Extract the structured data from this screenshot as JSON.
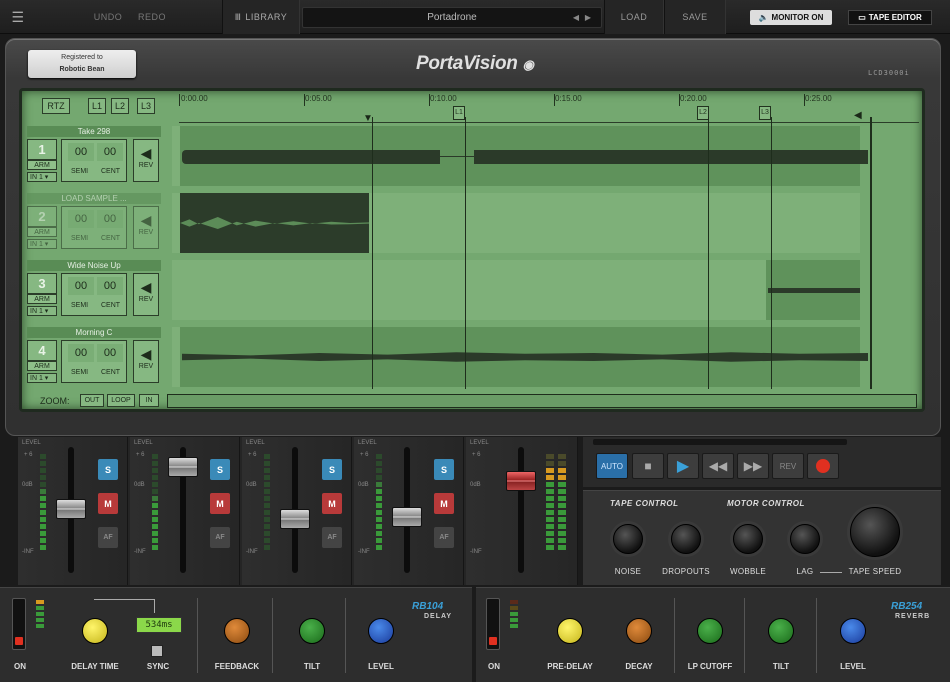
{
  "topbar": {
    "undo": "UNDO",
    "redo": "REDO",
    "library": "LIBRARY",
    "preset_name": "Portadrone",
    "load": "LOAD",
    "save": "SAVE",
    "monitor": "MONITOR ON",
    "tape_editor": "TAPE EDITOR"
  },
  "device": {
    "registered_line1": "Registered to",
    "registered_line2": "Robotic Bean",
    "logo": "PortaVision",
    "model": "LCD3000i"
  },
  "lcd": {
    "rtz": "RTZ",
    "l1": "L1",
    "l2": "L2",
    "l3": "L3",
    "timeline": [
      "0:00.00",
      "0:05.00",
      "0:10.00",
      "0:15.00",
      "0:20.00",
      "0:25.00"
    ],
    "markers": [
      "L1",
      "L2",
      "L3"
    ],
    "tracks": [
      {
        "name": "Take 298",
        "num": "1",
        "arm": "ARM",
        "input": "IN 1",
        "semi": "00",
        "cent": "00",
        "semi_label": "SEMI",
        "cent_label": "CENT",
        "rev": "REV"
      },
      {
        "name": "LOAD SAMPLE ...",
        "num": "2",
        "arm": "ARM",
        "input": "IN 1",
        "semi": "00",
        "cent": "00",
        "semi_label": "SEMI",
        "cent_label": "CENT",
        "rev": "REV"
      },
      {
        "name": "Wide Noise Up",
        "num": "3",
        "arm": "ARM",
        "input": "IN 1",
        "semi": "00",
        "cent": "00",
        "semi_label": "SEMI",
        "cent_label": "CENT",
        "rev": "REV"
      },
      {
        "name": "Morning C",
        "num": "4",
        "arm": "ARM",
        "input": "IN 1",
        "semi": "00",
        "cent": "00",
        "semi_label": "SEMI",
        "cent_label": "CENT",
        "rev": "REV"
      }
    ],
    "zoom": {
      "label": "ZOOM:",
      "out": "OUT",
      "loop": "LOOP",
      "in": "IN"
    }
  },
  "mixer": {
    "level": "LEVEL",
    "plus6": "+ 6",
    "zero": "0dB",
    "inf": "-INF",
    "solo": "S",
    "mute": "M",
    "af": "AF"
  },
  "transport": {
    "auto": "AUTO",
    "rev": "REV"
  },
  "tape_control": {
    "title_tape": "TAPE CONTROL",
    "title_motor": "MOTOR CONTROL",
    "noise": "NOISE",
    "dropouts": "DROPOUTS",
    "wobble": "WOBBLE",
    "lag": "LAG",
    "tape_speed": "TAPE SPEED"
  },
  "delay": {
    "on": "ON",
    "delay_time": "DELAY TIME",
    "time_value": "534ms",
    "sync": "SYNC",
    "feedback": "FEEDBACK",
    "tilt": "TILT",
    "level": "LEVEL",
    "model": "RB104",
    "type": "DELAY"
  },
  "reverb": {
    "on": "ON",
    "pre_delay": "PRE-DELAY",
    "decay": "DECAY",
    "lp_cutoff": "LP CUTOFF",
    "tilt": "TILT",
    "level": "LEVEL",
    "model": "RB254",
    "type": "REVERB"
  },
  "colors": {
    "lcd": "#74a870",
    "accent_blue": "#3aa0d8",
    "record": "#e03020",
    "delay_knob": "#e6d83a",
    "feedback_knob": "#c46b1f",
    "tilt_knob": "#2e8c3a",
    "level_knob": "#2a64c8"
  }
}
